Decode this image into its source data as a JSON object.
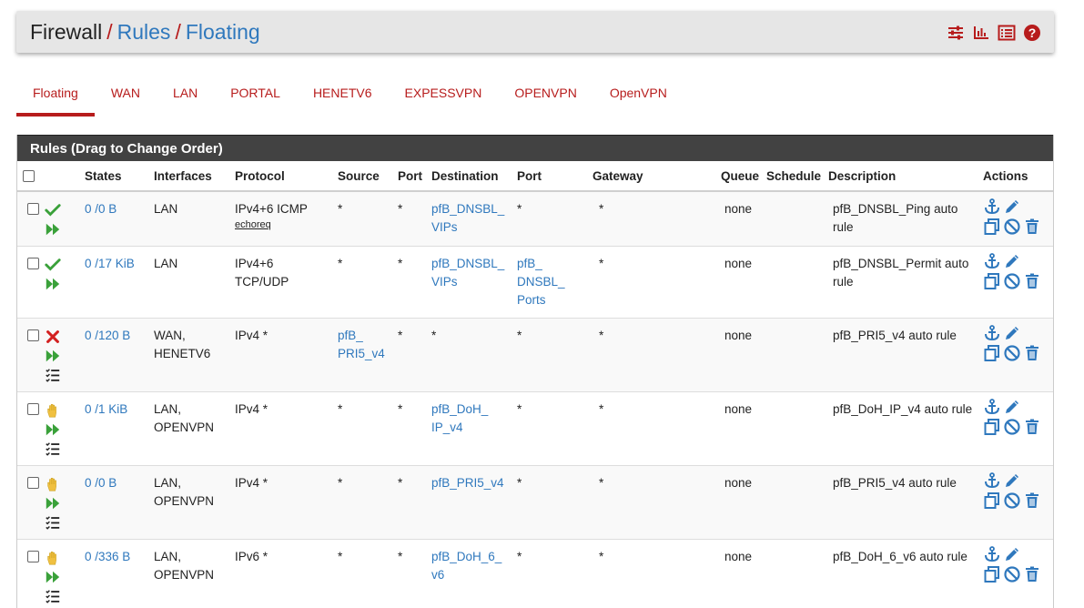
{
  "breadcrumb": {
    "root": "Firewall",
    "sep1": "/",
    "level2": "Rules",
    "sep2": "/",
    "level3": "Floating"
  },
  "header_icons": [
    "sliders-icon",
    "bar-chart-icon",
    "list-icon",
    "help-icon"
  ],
  "tabs": [
    {
      "label": "Floating",
      "active": true
    },
    {
      "label": "WAN"
    },
    {
      "label": "LAN"
    },
    {
      "label": "PORTAL"
    },
    {
      "label": "HENETV6"
    },
    {
      "label": "EXPESSVPN"
    },
    {
      "label": "OPENVPN"
    },
    {
      "label": "OpenVPN"
    }
  ],
  "panel": {
    "heading": "Rules (Drag to Change Order)"
  },
  "columns": {
    "states": "States",
    "interfaces": "Interfaces",
    "protocol": "Protocol",
    "source": "Source",
    "port": "Port",
    "destination": "Destination",
    "port2": "Port",
    "gateway": "Gateway",
    "queue": "Queue",
    "schedule": "Schedule",
    "description": "Description",
    "actions": "Actions"
  },
  "rules": [
    {
      "action": "pass",
      "states": "0 /0 B",
      "iface1": "LAN",
      "iface2": "",
      "proto1": "IPv4+6 ICMP",
      "proto2": "",
      "proto_sub": "echoreq",
      "src1": "*",
      "src2": "",
      "sport": "*",
      "dst1": "pfB_DNSBL_",
      "dst2": "VIPs",
      "dst3": "",
      "dport1": "*",
      "dport2": "",
      "dport3": "",
      "gateway": "*",
      "queue": "none",
      "schedule": "",
      "desc1": "pfB_DNSBL_Ping auto",
      "desc2": "rule"
    },
    {
      "action": "pass",
      "states": "0 /17 KiB",
      "iface1": "LAN",
      "iface2": "",
      "proto1": "IPv4+6",
      "proto2": "TCP/UDP",
      "proto_sub": "",
      "src1": "*",
      "src2": "",
      "sport": "*",
      "dst1": "pfB_DNSBL_",
      "dst2": "VIPs",
      "dst3": "",
      "dport1": "pfB_",
      "dport2": "DNSBL_",
      "dport3": "Ports",
      "gateway": "*",
      "queue": "none",
      "schedule": "",
      "desc1": "pfB_DNSBL_Permit auto",
      "desc2": "rule"
    },
    {
      "action": "block",
      "states": "0 /120 B",
      "iface1": "WAN,",
      "iface2": "HENETV6",
      "proto1": "IPv4 *",
      "proto2": "",
      "proto_sub": "",
      "src1": "pfB_",
      "src2": "PRI5_v4",
      "sport": "*",
      "dst1": "*",
      "dst2": "",
      "dst3": "",
      "dport1": "*",
      "dport2": "",
      "dport3": "",
      "gateway": "*",
      "queue": "none",
      "schedule": "",
      "desc1": "pfB_PRI5_v4 auto rule",
      "desc2": ""
    },
    {
      "action": "match",
      "states": "0 /1 KiB",
      "iface1": "LAN,",
      "iface2": "OPENVPN",
      "proto1": "IPv4 *",
      "proto2": "",
      "proto_sub": "",
      "src1": "*",
      "src2": "",
      "sport": "*",
      "dst1": "pfB_DoH_",
      "dst2": "IP_v4",
      "dst3": "",
      "dport1": "*",
      "dport2": "",
      "dport3": "",
      "gateway": "*",
      "queue": "none",
      "schedule": "",
      "desc1": "pfB_DoH_IP_v4 auto rule",
      "desc2": ""
    },
    {
      "action": "match",
      "states": "0 /0 B",
      "iface1": "LAN,",
      "iface2": "OPENVPN",
      "proto1": "IPv4 *",
      "proto2": "",
      "proto_sub": "",
      "src1": "*",
      "src2": "",
      "sport": "*",
      "dst1": "pfB_PRI5_v4",
      "dst2": "",
      "dst3": "",
      "dport1": "*",
      "dport2": "",
      "dport3": "",
      "gateway": "*",
      "queue": "none",
      "schedule": "",
      "desc1": "pfB_PRI5_v4 auto rule",
      "desc2": ""
    },
    {
      "action": "match",
      "states": "0 /336 B",
      "iface1": "LAN,",
      "iface2": "OPENVPN",
      "proto1": "IPv6 *",
      "proto2": "",
      "proto_sub": "",
      "src1": "*",
      "src2": "",
      "sport": "*",
      "dst1": "pfB_DoH_6_",
      "dst2": "v6",
      "dst3": "",
      "dport1": "*",
      "dport2": "",
      "dport3": "",
      "gateway": "*",
      "queue": "none",
      "schedule": "",
      "desc1": "pfB_DoH_6_v6 auto rule",
      "desc2": ""
    }
  ],
  "colors": {
    "accent_red": "#b71c1c",
    "link_blue": "#2f78bd",
    "pass_green": "#3aa13a",
    "block_red": "#d32020",
    "match_yellow": "#f0c040",
    "panel_heading": "#424242"
  }
}
